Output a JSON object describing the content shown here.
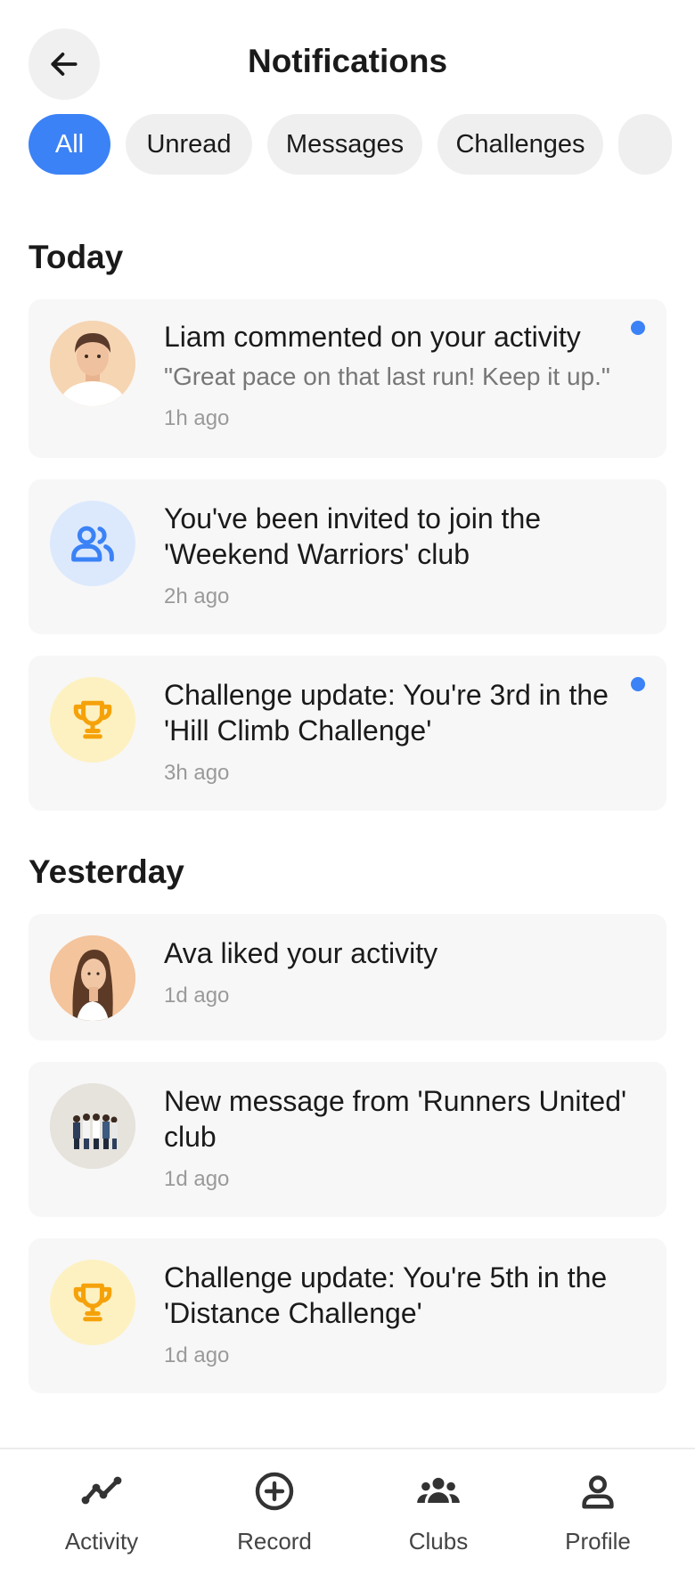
{
  "header": {
    "title": "Notifications"
  },
  "filters": [
    "All",
    "Unread",
    "Messages",
    "Challenges",
    ""
  ],
  "sections": {
    "today": "Today",
    "yesterday": "Yesterday"
  },
  "notifications": [
    {
      "message": "Liam commented on your activity",
      "quote": "\"Great pace on that last run! Keep it up.\"",
      "time": "1h ago",
      "unread": true,
      "icon": "avatar-liam"
    },
    {
      "message": "You've been invited to join the 'Weekend Warriors' club",
      "time": "2h ago",
      "unread": false,
      "icon": "group-icon"
    },
    {
      "message": "Challenge update: You're 3rd in the 'Hill Climb Challenge'",
      "time": "3h ago",
      "unread": true,
      "icon": "trophy-icon"
    },
    {
      "message": "Ava liked your activity",
      "time": "1d ago",
      "unread": false,
      "icon": "avatar-ava"
    },
    {
      "message": "New message from 'Runners United' club",
      "time": "1d ago",
      "unread": false,
      "icon": "club-photo"
    },
    {
      "message": "Challenge update: You're 5th in the 'Distance Challenge'",
      "time": "1d ago",
      "unread": false,
      "icon": "trophy-icon"
    }
  ],
  "nav": [
    "Activity",
    "Record",
    "Clubs",
    "Profile"
  ],
  "colors": {
    "accent": "#3b82f6",
    "trophy_bg": "#fdf1c2",
    "trophy": "#f5a20a",
    "group_bg": "#dce9fd"
  }
}
